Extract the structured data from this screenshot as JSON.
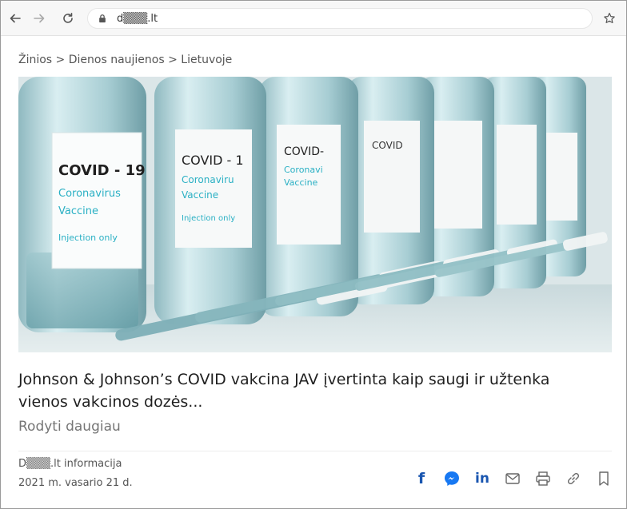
{
  "browser": {
    "url": "d▒▒▒.lt"
  },
  "article": {
    "breadcrumb": "Žinios > Dienos naujienos > Lietuvoje",
    "headline": "Johnson & Johnson’s COVID vakcina JAV įvertinta kaip saugi ir užtenka vienos vakcinos dozės...",
    "more_label": "Rodyti daugiau",
    "source": "D▒▒▒.lt informacija",
    "date": "2021 m. vasario 21 d.",
    "vial_label": {
      "line1": "COVID - 19",
      "line2": "Coronavirus",
      "line3": "Vaccine",
      "line4": "Injection only"
    }
  },
  "colors": {
    "label_teal": "#2ab0c4",
    "share_blue": "#1a56b0",
    "messenger_blue": "#1778f2"
  },
  "icons": {
    "back": "arrow-left-icon",
    "forward": "arrow-right-icon",
    "reload": "reload-icon",
    "lock": "lock-icon",
    "bookmark_star": "star-icon",
    "share": [
      "facebook-icon",
      "messenger-icon",
      "linkedin-icon",
      "email-icon",
      "print-icon",
      "link-icon",
      "bookmark-icon"
    ]
  }
}
